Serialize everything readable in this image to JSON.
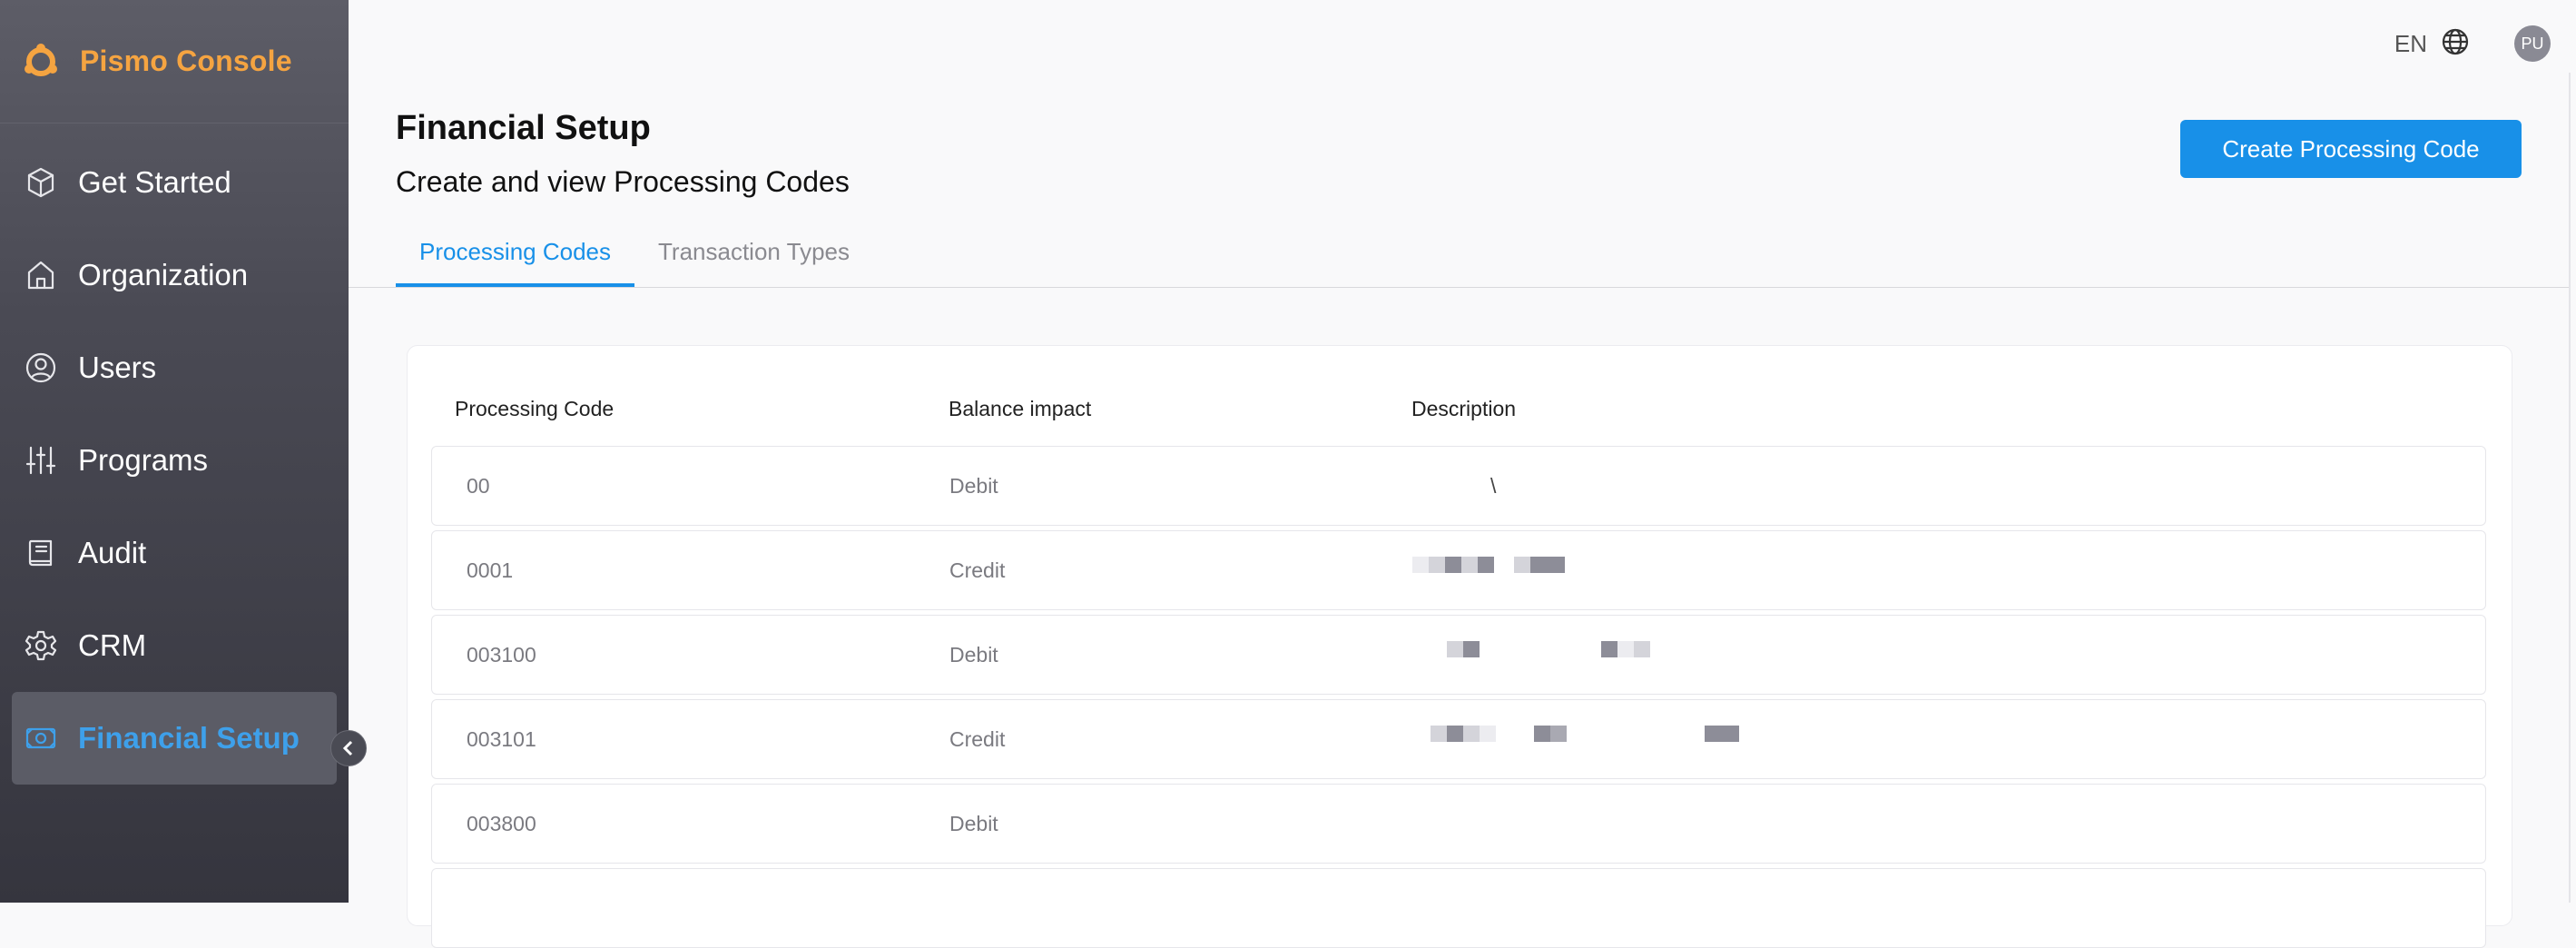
{
  "app": {
    "title": "Pismo Console"
  },
  "sidebar": {
    "items": [
      {
        "label": "Get Started",
        "icon": "cube-icon"
      },
      {
        "label": "Organization",
        "icon": "home-icon"
      },
      {
        "label": "Users",
        "icon": "user-circle-icon"
      },
      {
        "label": "Programs",
        "icon": "sliders-icon"
      },
      {
        "label": "Audit",
        "icon": "book-icon"
      },
      {
        "label": "CRM",
        "icon": "gear-icon"
      },
      {
        "label": "Financial Setup",
        "icon": "money-icon",
        "active": true
      }
    ]
  },
  "topbar": {
    "language": "EN",
    "avatar_initials": "PU"
  },
  "page": {
    "title": "Financial Setup",
    "subtitle": "Create and view Processing Codes",
    "create_button": "Create Processing Code"
  },
  "tabs": [
    {
      "label": "Processing Codes",
      "active": true
    },
    {
      "label": "Transaction Types",
      "active": false
    }
  ],
  "table": {
    "headers": [
      "Processing Code",
      "Balance impact",
      "Description"
    ],
    "rows": [
      {
        "code": "00",
        "impact": "Debit",
        "description": "\\"
      },
      {
        "code": "0001",
        "impact": "Credit",
        "description": ""
      },
      {
        "code": "003100",
        "impact": "Debit",
        "description": ""
      },
      {
        "code": "003101",
        "impact": "Credit",
        "description": ""
      },
      {
        "code": "003800",
        "impact": "Debit",
        "description": ""
      }
    ]
  },
  "colors": {
    "accent": "#1890e8",
    "brand": "#f5a441",
    "active_nav": "#3ea0ea"
  }
}
